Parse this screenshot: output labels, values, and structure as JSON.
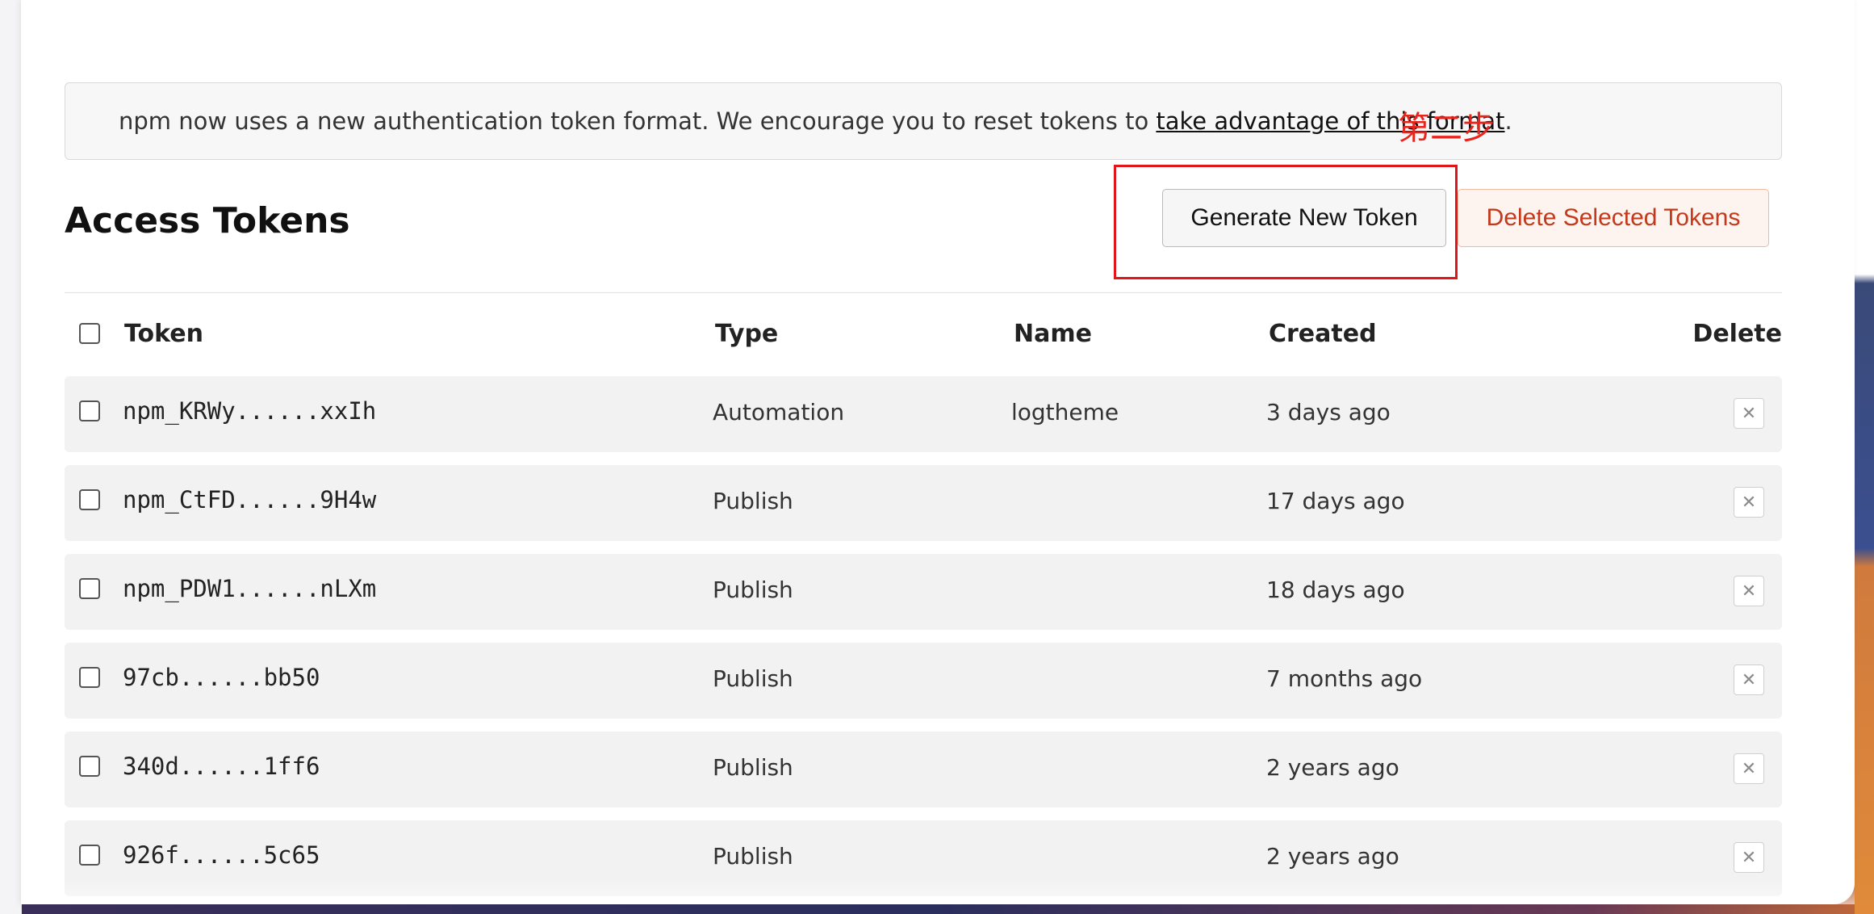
{
  "banner": {
    "text": "npm now uses a new authentication token format. We encourage you to reset tokens to ",
    "link": "take advantage of this format",
    "suffix": "."
  },
  "annotation": {
    "step_label": "第二步",
    "color": "#e0161b"
  },
  "page": {
    "title": "Access Tokens"
  },
  "actions": {
    "generate_label": "Generate New Token",
    "delete_selected_label": "Delete Selected Tokens"
  },
  "table": {
    "headers": {
      "token": "Token",
      "type": "Type",
      "name": "Name",
      "created": "Created",
      "delete": "Delete"
    },
    "rows": [
      {
        "token": "npm_KRWy......xxIh",
        "type": "Automation",
        "name": "logtheme",
        "created": "3 days ago"
      },
      {
        "token": "npm_CtFD......9H4w",
        "type": "Publish",
        "name": "",
        "created": "17 days ago"
      },
      {
        "token": "npm_PDW1......nLXm",
        "type": "Publish",
        "name": "",
        "created": "18 days ago"
      },
      {
        "token": "97cb......bb50",
        "type": "Publish",
        "name": "",
        "created": "7 months ago"
      },
      {
        "token": "340d......1ff6",
        "type": "Publish",
        "name": "",
        "created": "2 years ago"
      },
      {
        "token": "926f......5c65",
        "type": "Publish",
        "name": "",
        "created": "2 years ago"
      }
    ]
  },
  "icons": {
    "delete_row": "close-icon",
    "delete_glyph": "✕"
  },
  "colors": {
    "danger": "#c2391b",
    "danger_bg": "#fdf3ef",
    "row_bg": "#f2f2f2"
  }
}
